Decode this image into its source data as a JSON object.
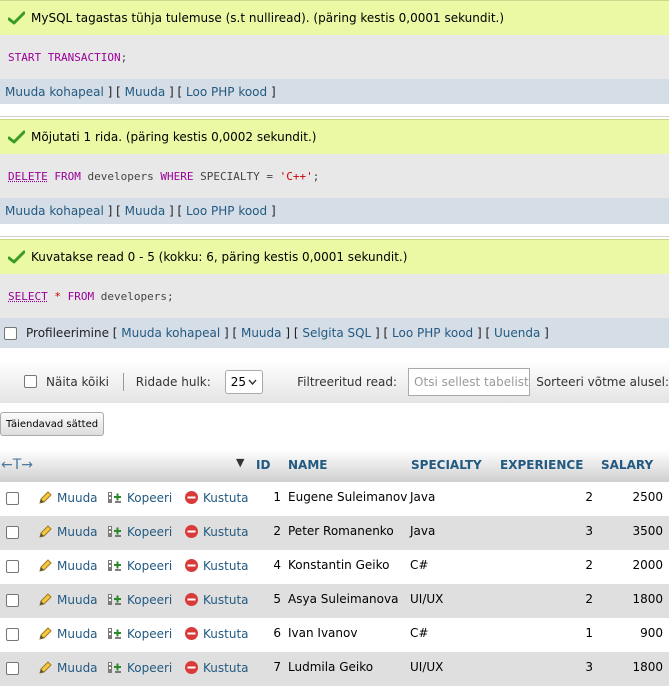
{
  "messages": [
    {
      "notice": "MySQL tagastas tühja tulemuse (s.t nulliread). (päring kestis 0,0001 sekundit.)",
      "sql": [
        {
          "t": "START TRANSACTION",
          "c": "kw"
        },
        {
          "t": ";",
          "c": ""
        }
      ],
      "links": [
        "Muuda kohapeal",
        "Muuda",
        "Loo PHP kood"
      ]
    },
    {
      "notice": "Mõjutati 1 rida. (päring kestis 0,0002 sekundit.)",
      "sql": [
        {
          "t": "DELETE",
          "c": "kw ul"
        },
        {
          "t": " ",
          "c": ""
        },
        {
          "t": "FROM",
          "c": "kw"
        },
        {
          "t": " developers ",
          "c": ""
        },
        {
          "t": "WHERE",
          "c": "kw"
        },
        {
          "t": " SPECIALTY = ",
          "c": ""
        },
        {
          "t": "'C++'",
          "c": "str"
        },
        {
          "t": ";",
          "c": ""
        }
      ],
      "links": [
        "Muuda kohapeal",
        "Muuda",
        "Loo PHP kood"
      ]
    },
    {
      "notice": "Kuvatakse read 0 - 5 (kokku: 6, päring kestis 0,0001 sekundit.)",
      "sql": [
        {
          "t": "SELECT",
          "c": "kw ul"
        },
        {
          "t": " ",
          "c": ""
        },
        {
          "t": "*",
          "c": "str"
        },
        {
          "t": " ",
          "c": ""
        },
        {
          "t": "FROM",
          "c": "kw"
        },
        {
          "t": " developers;",
          "c": ""
        }
      ]
    }
  ],
  "profiling": {
    "label": "Profileerimine",
    "links": [
      "Muuda kohapeal",
      "Muuda",
      "Selgita SQL",
      "Loo PHP kood",
      "Uuenda"
    ]
  },
  "nav": {
    "show_all": "Näita kõiki",
    "rows_label": "Ridade hulk:",
    "rows_value": "25",
    "filter_label": "Filtreeritud read:",
    "filter_placeholder": "Otsi sellest tabelist",
    "sort_label": "Sorteeri võtme alusel:"
  },
  "extra_options_button": "Täiendavad sätted",
  "table": {
    "toggle_glyph": "←T→",
    "sort_icon": "▼",
    "columns": [
      "ID",
      "NAME",
      "SPECIALTY",
      "EXPERIENCE",
      "SALARY"
    ],
    "actions": {
      "edit": "Muuda",
      "copy": "Kopeeri",
      "delete": "Kustuta"
    },
    "rows": [
      {
        "id": "1",
        "name": "Eugene Suleimanov",
        "specialty": "Java",
        "experience": "2",
        "salary": "2500"
      },
      {
        "id": "2",
        "name": "Peter Romanenko",
        "specialty": "Java",
        "experience": "3",
        "salary": "3500"
      },
      {
        "id": "4",
        "name": "Konstantin Geiko",
        "specialty": "C#",
        "experience": "2",
        "salary": "2000"
      },
      {
        "id": "5",
        "name": "Asya Suleimanova",
        "specialty": "UI/UX",
        "experience": "2",
        "salary": "1800"
      },
      {
        "id": "6",
        "name": "Ivan Ivanov",
        "specialty": "C#",
        "experience": "1",
        "salary": "900"
      },
      {
        "id": "7",
        "name": "Ludmila Geiko",
        "specialty": "UI/UX",
        "experience": "3",
        "salary": "1800"
      }
    ]
  },
  "colors": {
    "notice_bg": "#ebf8a4",
    "link": "#235a81",
    "keyword": "#990099",
    "string": "#cc0000"
  }
}
